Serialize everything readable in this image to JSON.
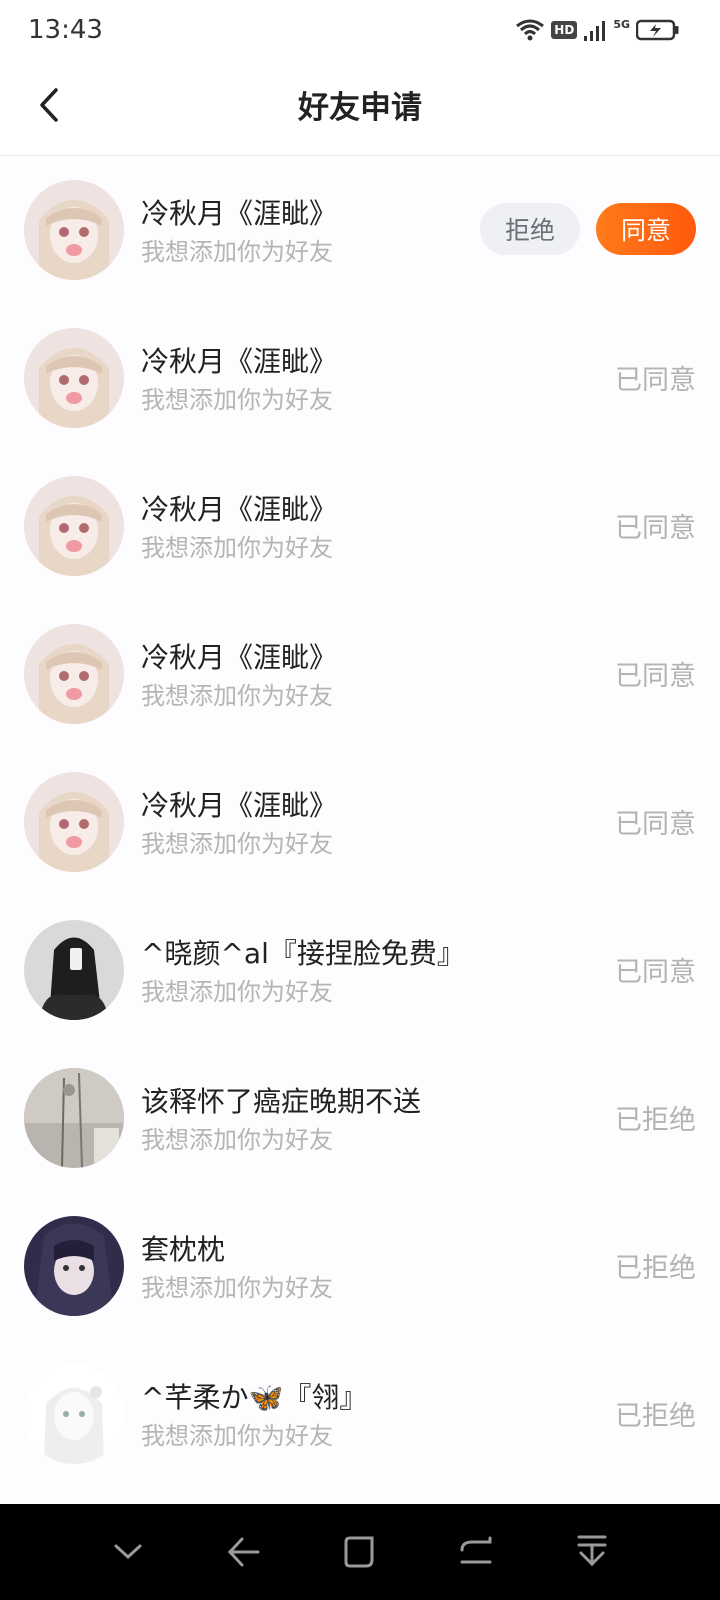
{
  "status_bar": {
    "time": "13:43",
    "icons": [
      "wifi-icon",
      "hd-icon",
      "signal-icon",
      "5g-icon",
      "battery-icon"
    ],
    "hd_label": "HD",
    "network_label": "5G"
  },
  "header": {
    "title": "好友申请",
    "back_icon": "chevron-left-icon"
  },
  "requests": [
    {
      "name": "冷秋月《涯眦》",
      "message": "我想添加你为好友",
      "status": "pending",
      "reject_label": "拒绝",
      "accept_label": "同意",
      "avatar": "doll-avatar"
    },
    {
      "name": "冷秋月《涯眦》",
      "message": "我想添加你为好友",
      "status_label": "已同意",
      "avatar": "doll-avatar"
    },
    {
      "name": "冷秋月《涯眦》",
      "message": "我想添加你为好友",
      "status_label": "已同意",
      "avatar": "doll-avatar"
    },
    {
      "name": "冷秋月《涯眦》",
      "message": "我想添加你为好友",
      "status_label": "已同意",
      "avatar": "doll-avatar"
    },
    {
      "name": "冷秋月《涯眦》",
      "message": "我想添加你为好友",
      "status_label": "已同意",
      "avatar": "doll-avatar"
    },
    {
      "name": "^晓颜^al『接捏脸免费』",
      "message": "我想添加你为好友",
      "status_label": "已同意",
      "avatar": "dark-hair-avatar"
    },
    {
      "name": "该释怀了癌症晚期不送",
      "message": "我想添加你为好友",
      "status_label": "已拒绝",
      "avatar": "gray-photo-avatar"
    },
    {
      "name": "套枕枕",
      "message": "我想添加你为好友",
      "status_label": "已拒绝",
      "avatar": "girl-photo-avatar"
    },
    {
      "name": "^芊柔か🦋『翎』",
      "message": "我想添加你为好友",
      "status_label": "已拒绝",
      "avatar": "white-doll-avatar"
    }
  ],
  "colors": {
    "accent": "#ff5a0d",
    "reject_bg": "#eef0f4",
    "muted_text": "#b3b3b3"
  },
  "nav_bar": {
    "icons": [
      "chevron-down-icon",
      "back-arrow-icon",
      "home-square-icon",
      "recents-icon",
      "pull-down-icon"
    ]
  }
}
